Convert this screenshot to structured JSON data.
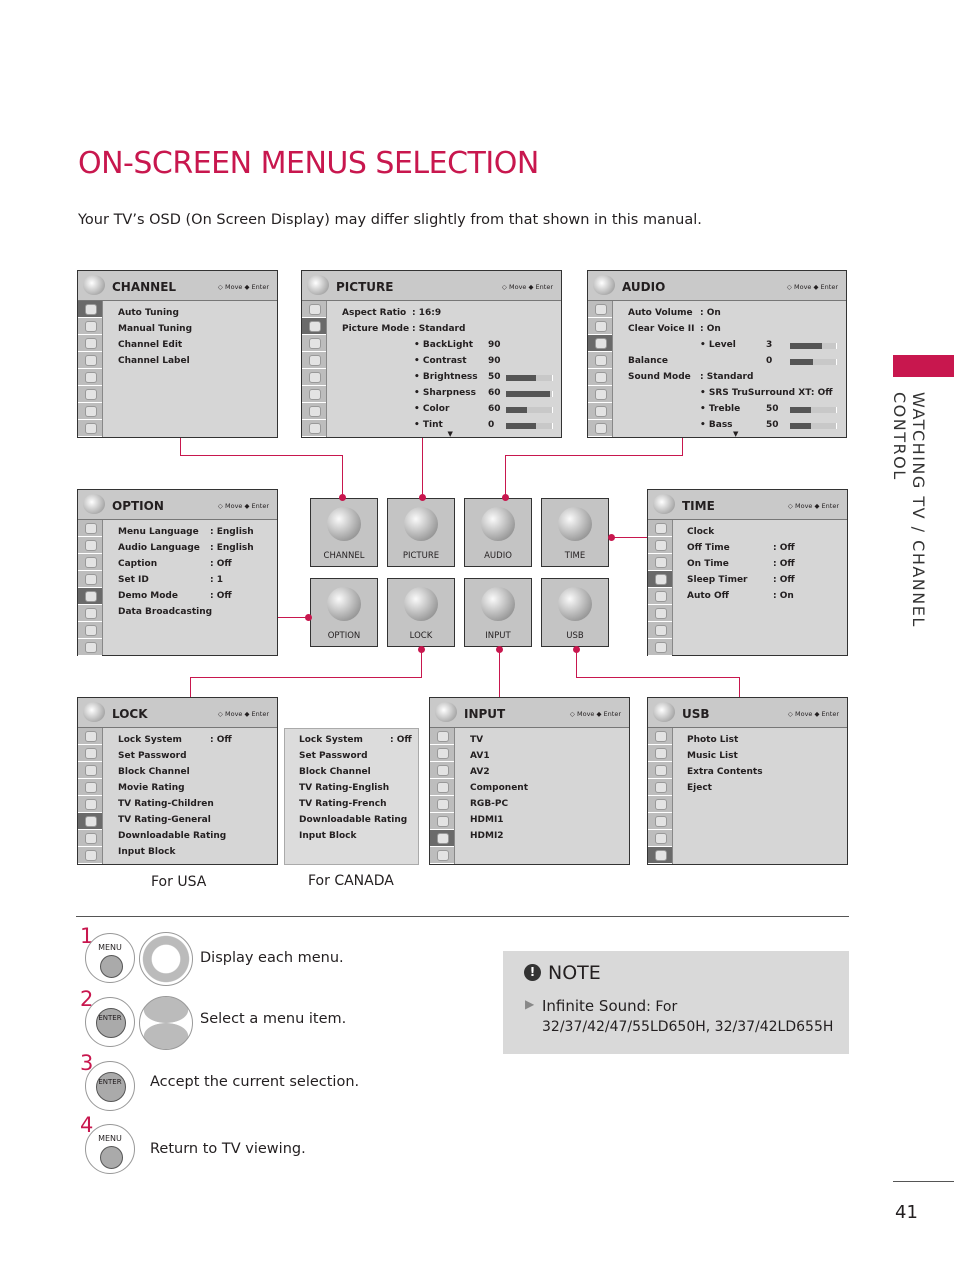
{
  "page": {
    "title": "ON-SCREEN MENUS SELECTION",
    "subtitle": "Your TV’s OSD (On Screen Display) may differ slightly from that shown in this manual.",
    "side_tab": "WATCHING TV / CHANNEL CONTROL",
    "page_number": "41",
    "accent": "#c8174e"
  },
  "hints": {
    "move": "Move",
    "enter": "Enter"
  },
  "panels": {
    "channel": {
      "title": "CHANNEL",
      "icon": "satellite-dish-icon",
      "selected": 0,
      "items": [
        {
          "label": "Auto Tuning"
        },
        {
          "label": "Manual Tuning"
        },
        {
          "label": "Channel Edit"
        },
        {
          "label": "Channel Label"
        }
      ]
    },
    "picture": {
      "title": "PICTURE",
      "icon": "tv-icon",
      "selected": 1,
      "more": true,
      "items": [
        {
          "label": "Aspect Ratio",
          "value": ": 16:9"
        },
        {
          "label": "Picture Mode",
          "value": ": Standard"
        },
        {
          "label": "• BackLight",
          "value": "90",
          "bullet": true
        },
        {
          "label": "• Contrast",
          "value": "90",
          "bullet": true
        },
        {
          "label": "• Brightness",
          "value": "50",
          "bullet": true,
          "bar": 0.65
        },
        {
          "label": "• Sharpness",
          "value": "60",
          "bullet": true,
          "bar": 0.95
        },
        {
          "label": "• Color",
          "value": "60",
          "bullet": true,
          "bar": 0.45
        },
        {
          "label": "• Tint",
          "value": "0",
          "bullet": true,
          "bar": 0.65
        }
      ]
    },
    "audio": {
      "title": "AUDIO",
      "icon": "speaker-icon",
      "selected": 2,
      "more": true,
      "items": [
        {
          "label": "Auto Volume",
          "value": ": On"
        },
        {
          "label": "Clear Voice II",
          "value": ": On"
        },
        {
          "label": "• Level",
          "value": "3",
          "bullet": true,
          "bar": 0.7
        },
        {
          "label": "Balance",
          "value": "0",
          "bar": 0.5
        },
        {
          "label": "Sound Mode",
          "value": ": Standard"
        },
        {
          "label": "• SRS TruSurround XT:  Off",
          "bullet": true
        },
        {
          "label": "• Treble",
          "value": "50",
          "bullet": true,
          "bar": 0.45
        },
        {
          "label": "• Bass",
          "value": "50",
          "bullet": true,
          "bar": 0.45
        }
      ]
    },
    "option": {
      "title": "OPTION",
      "icon": "toolbox-icon",
      "selected": 4,
      "items": [
        {
          "label": "Menu Language",
          "value": ": English"
        },
        {
          "label": "Audio Language",
          "value": ": English"
        },
        {
          "label": "Caption",
          "value": ": Off"
        },
        {
          "label": "Set ID",
          "value": ": 1"
        },
        {
          "label": "Demo Mode",
          "value": ": Off"
        },
        {
          "label": "Data Broadcasting"
        }
      ]
    },
    "time": {
      "title": "TIME",
      "icon": "clock-icon",
      "selected": 3,
      "items": [
        {
          "label": "Clock"
        },
        {
          "label": "Off Time",
          "value": ": Off"
        },
        {
          "label": "On Time",
          "value": ": Off"
        },
        {
          "label": "Sleep Timer",
          "value": ": Off"
        },
        {
          "label": "Auto Off",
          "value": ": On"
        }
      ]
    },
    "lock": {
      "title": "LOCK",
      "icon": "padlock-icon",
      "selected": 5,
      "caption": "For USA",
      "items": [
        {
          "label": "Lock System",
          "value": ": Off"
        },
        {
          "label": "Set Password"
        },
        {
          "label": "Block Channel"
        },
        {
          "label": "Movie Rating"
        },
        {
          "label": "TV Rating-Children"
        },
        {
          "label": "TV Rating-General"
        },
        {
          "label": "Downloadable Rating"
        },
        {
          "label": "Input Block"
        }
      ]
    },
    "lock_canada": {
      "caption": "For CANADA",
      "items": [
        {
          "label": "Lock System",
          "value": ": Off"
        },
        {
          "label": "Set Password"
        },
        {
          "label": "Block Channel"
        },
        {
          "label": "TV Rating-English"
        },
        {
          "label": "TV Rating-French"
        },
        {
          "label": "Downloadable Rating"
        },
        {
          "label": "Input Block"
        }
      ]
    },
    "input": {
      "title": "INPUT",
      "icon": "input-cable-icon",
      "selected": 6,
      "items": [
        {
          "label": "TV"
        },
        {
          "label": "AV1"
        },
        {
          "label": "AV2"
        },
        {
          "label": "Component"
        },
        {
          "label": "RGB-PC"
        },
        {
          "label": "HDMI1"
        },
        {
          "label": "HDMI2"
        }
      ]
    },
    "usb": {
      "title": "USB",
      "icon": "photo-folder-icon",
      "selected": 7,
      "items": [
        {
          "label": "Photo List"
        },
        {
          "label": "Music List"
        },
        {
          "label": "Extra Contents"
        },
        {
          "label": "Eject"
        }
      ]
    }
  },
  "tiles": [
    "CHANNEL",
    "PICTURE",
    "AUDIO",
    "TIME",
    "OPTION",
    "LOCK",
    "INPUT",
    "USB"
  ],
  "steps": [
    {
      "num": "1",
      "button": "MENU",
      "text": "Display each menu."
    },
    {
      "num": "2",
      "button": "ENTER",
      "text": "Select a menu item."
    },
    {
      "num": "3",
      "button": "ENTER",
      "text": "Accept the current selection."
    },
    {
      "num": "4",
      "button": "MENU",
      "text": "Return to TV viewing."
    }
  ],
  "note": {
    "heading": "NOTE",
    "term": "Infinite Sound",
    "text": ": For 32/37/42/47/55LD650H, 32/37/42LD655H"
  }
}
